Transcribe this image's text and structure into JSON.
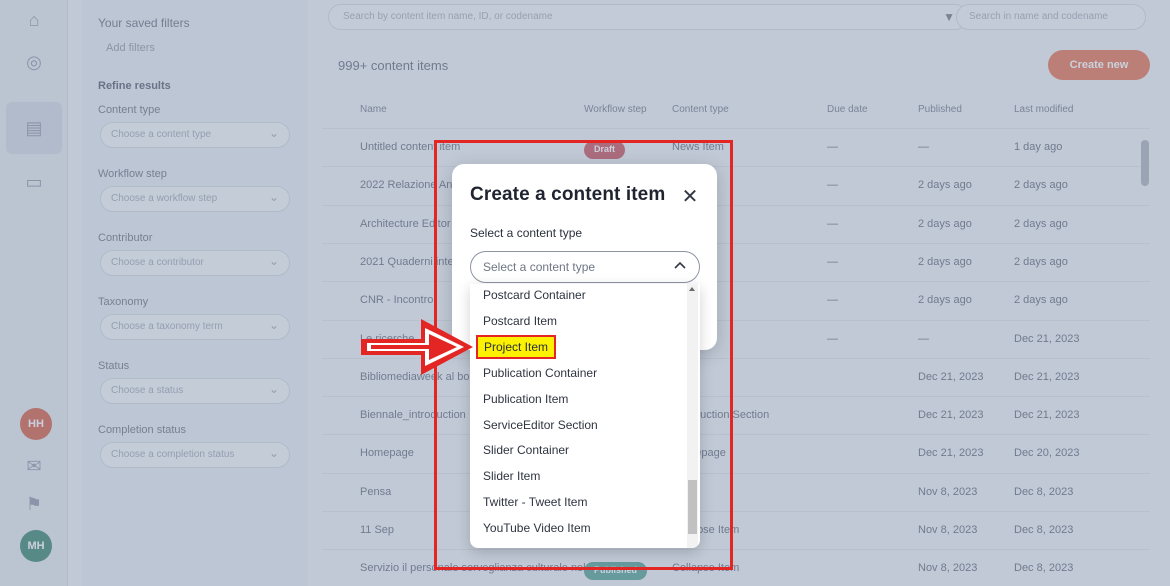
{
  "background": {
    "rail": {
      "avatar_initials": "MH",
      "notification_initials": "HH"
    },
    "filters": {
      "saved_filters_title": "Your saved filters",
      "saved_filters_empty": "Add filters",
      "refine_title": "Refine results",
      "fields": [
        {
          "label": "Content type",
          "placeholder": "Choose a content type"
        },
        {
          "label": "Workflow step",
          "placeholder": "Choose a workflow step"
        },
        {
          "label": "Contributor",
          "placeholder": "Choose a contributor"
        },
        {
          "label": "Taxonomy",
          "placeholder": "Choose a taxonomy term"
        },
        {
          "label": "Status",
          "placeholder": "Choose a status"
        },
        {
          "label": "Completion status",
          "placeholder": "Choose a completion status"
        }
      ]
    },
    "search_placeholder": "Search by content item name, ID, or codename",
    "search_scope": "Search in name and codename",
    "item_count": "999+ content items",
    "create_button": "Create new",
    "columns": [
      "Name",
      "Workflow step",
      "Content type",
      "Due date",
      "Published",
      "Last modified"
    ],
    "rows": [
      {
        "name": "Untitled content item",
        "badge": "Draft",
        "type": "News Item",
        "due": "—",
        "published": "—",
        "modified": "1 day ago"
      },
      {
        "name": "2022 Relazione Annuale",
        "badge": "",
        "type": "Item",
        "due": "—",
        "published": "2 days ago",
        "modified": "2 days ago"
      },
      {
        "name": "Architecture Editor",
        "badge": "",
        "type": "Item",
        "due": "—",
        "published": "2 days ago",
        "modified": "2 days ago"
      },
      {
        "name": "2021 Quaderni interni",
        "badge": "",
        "type": "Item",
        "due": "—",
        "published": "2 days ago",
        "modified": "2 days ago"
      },
      {
        "name": "CNR - Incontro",
        "badge": "",
        "type": "Item",
        "due": "—",
        "published": "2 days ago",
        "modified": "2 days ago"
      },
      {
        "name": "Le ricerche",
        "badge": "",
        "type": "",
        "due": "—",
        "published": "—",
        "modified": "Dec 21, 2023"
      },
      {
        "name": "Bibliomediaweek al bo",
        "badge": "",
        "type": "",
        "due": "",
        "published": "Dec 21, 2023",
        "modified": "Dec 21, 2023"
      },
      {
        "name": "Biennale_introduction",
        "badge": "",
        "type": "Introduction Section",
        "due": "",
        "published": "Dec 21, 2023",
        "modified": "Dec 21, 2023"
      },
      {
        "name": "Homepage",
        "badge": "",
        "type": "Homepage",
        "due": "",
        "published": "Dec 21, 2023",
        "modified": "Dec 20, 2023"
      },
      {
        "name": "Pensa",
        "badge": "",
        "type": "",
        "due": "",
        "published": "Nov 8, 2023",
        "modified": "Dec 8, 2023"
      },
      {
        "name": "11 Sep",
        "badge": "",
        "type": "Collapse Item",
        "due": "",
        "published": "Nov 8, 2023",
        "modified": "Dec 8, 2023"
      },
      {
        "name": "Servizio il personale sorveglianza culturale nel lun",
        "badge": "Published",
        "type": "Collapse Item",
        "due": "",
        "published": "Nov 8, 2023",
        "modified": "Dec 8, 2023"
      }
    ]
  },
  "modal": {
    "title": "Create a content item",
    "label": "Select a content type",
    "select_placeholder": "Select a content type",
    "options": [
      "Postcard Container",
      "Postcard Item",
      "Project Item",
      "Publication Container",
      "Publication Item",
      "ServiceEditor Section",
      "Slider Container",
      "Slider Item",
      "Twitter - Tweet Item",
      "YouTube Video Item"
    ],
    "highlighted_option": "Project Item"
  },
  "colors": {
    "annotation_red": "#e32623",
    "highlight_yellow": "#fbf100",
    "accent_orange": "#e46a47",
    "draft_badge": "#c74a55",
    "published_badge": "#4a9b8c"
  },
  "icons": {
    "close": "close-icon",
    "chevron": "chevron-up-icon",
    "arrow": "right-arrow-annotation"
  }
}
